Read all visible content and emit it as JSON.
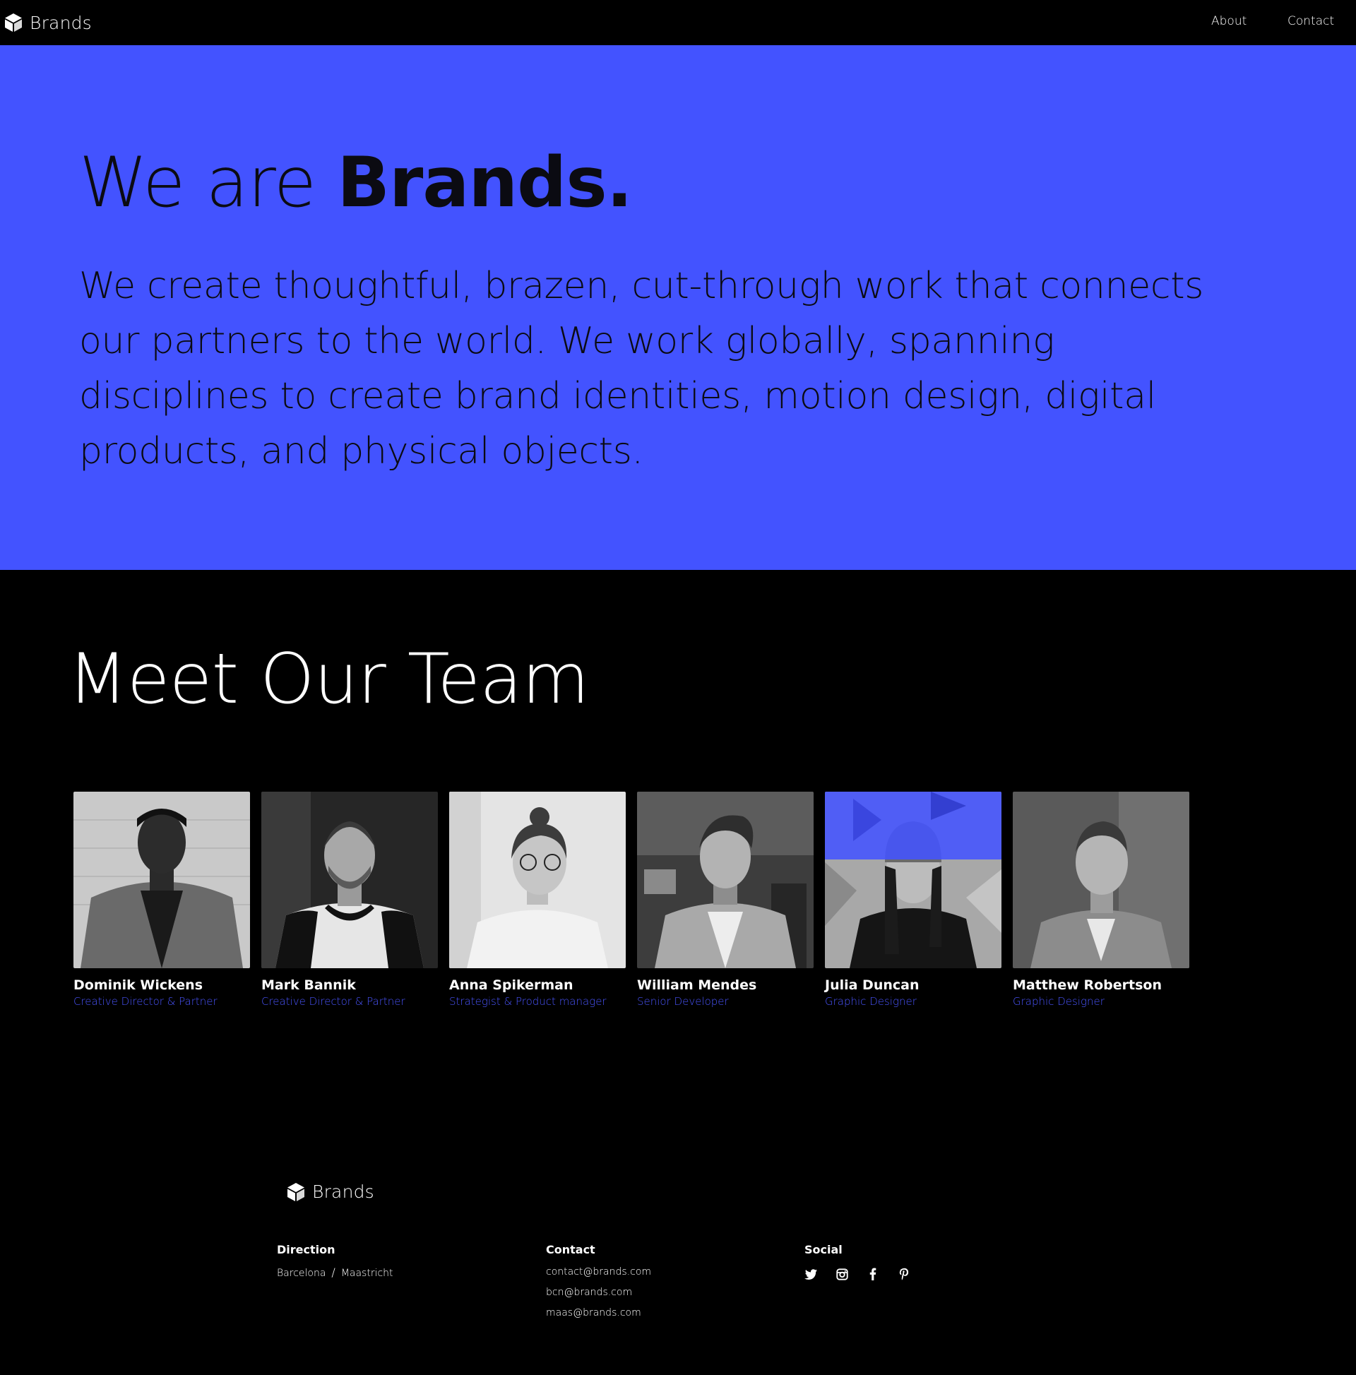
{
  "nav": {
    "brand": "Brands",
    "links": [
      "About",
      "Contact"
    ]
  },
  "hero": {
    "title_light": "We are ",
    "title_bold": "Brands.",
    "text": "We create thoughtful, brazen, cut-through work that connects our partners to the world. We work globally, spanning disciplines to create brand identities, motion design, digital products, and physical objects.",
    "background_color": "#4353ff"
  },
  "team": {
    "title": "Meet Our Team",
    "members": [
      {
        "name": "Dominik Wickens",
        "role": "Creative Director & Partner"
      },
      {
        "name": "Mark Bannik",
        "role": "Creative Director & Partner"
      },
      {
        "name": "Anna Spikerman",
        "role": "Strategist & Product manager"
      },
      {
        "name": "William Mendes",
        "role": "Senior Developer"
      },
      {
        "name": "Julia Duncan",
        "role": "Graphic Designer"
      },
      {
        "name": "Matthew Robertson",
        "role": "Graphic Designer"
      }
    ],
    "role_color": "#4a55ff"
  },
  "footer": {
    "brand": "Brands",
    "direction": {
      "heading": "Direction",
      "city_1": "Barcelona",
      "separator": "/",
      "city_2": "Maastricht"
    },
    "contact": {
      "heading": "Contact",
      "emails": [
        "contact@brands.com",
        "bcn@brands.com",
        "maas@brands.com"
      ]
    },
    "social": {
      "heading": "Social",
      "icons": [
        "twitter-icon",
        "instagram-icon",
        "facebook-icon",
        "pinterest-icon"
      ]
    }
  }
}
